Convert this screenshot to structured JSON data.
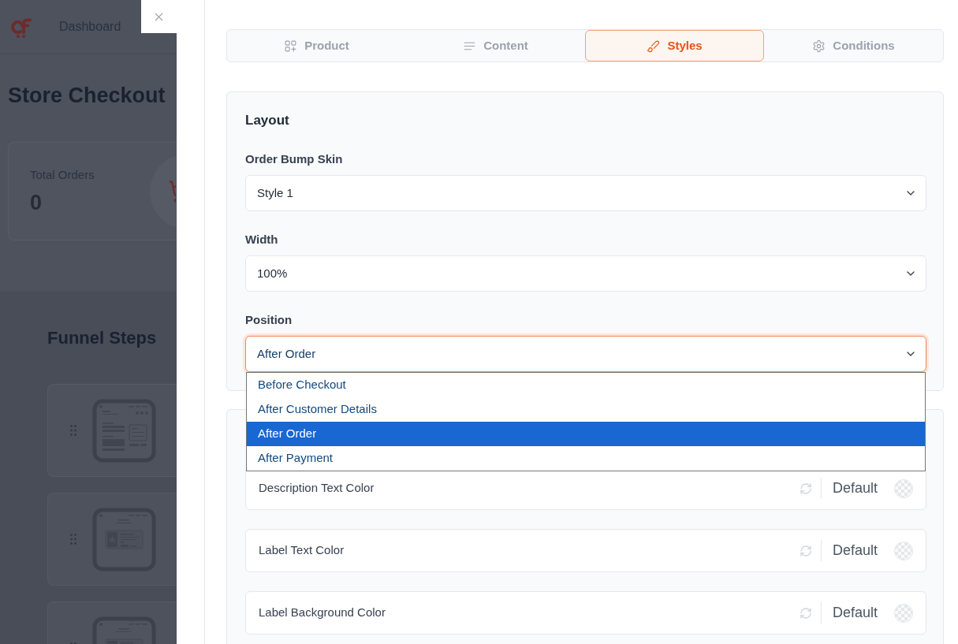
{
  "background_page": {
    "header": {
      "nav_label": "Dashboard"
    },
    "title": "Store Checkout",
    "stats_card": {
      "label": "Total Orders",
      "value": "0"
    },
    "funnel_steps": {
      "title": "Funnel Steps",
      "steps": [
        {
          "kind": "form"
        },
        {
          "kind": "offer"
        },
        {
          "kind": "offer"
        }
      ]
    }
  },
  "panel": {
    "tabs": [
      {
        "label": "Product",
        "selected": false
      },
      {
        "label": "Content",
        "selected": false
      },
      {
        "label": "Styles",
        "selected": true
      },
      {
        "label": "Conditions",
        "selected": false
      }
    ],
    "layout": {
      "title": "Layout",
      "fields": [
        {
          "label": "Order Bump Skin",
          "value": "Style 1",
          "expanded": false
        },
        {
          "label": "Width",
          "value": "100%",
          "expanded": false
        },
        {
          "label": "Position",
          "value": "After Order",
          "expanded": true,
          "options": [
            {
              "label": "Before Checkout",
              "selected": false
            },
            {
              "label": "After Customer Details",
              "selected": false
            },
            {
              "label": "After Order",
              "selected": true
            },
            {
              "label": "After Payment",
              "selected": false
            }
          ]
        }
      ]
    },
    "colors": {
      "rows": [
        {
          "label": "Description Text Color",
          "value": "Default"
        },
        {
          "label": "Label Text Color",
          "value": "Default"
        },
        {
          "label": "Label Background Color",
          "value": "Default"
        }
      ]
    }
  }
}
